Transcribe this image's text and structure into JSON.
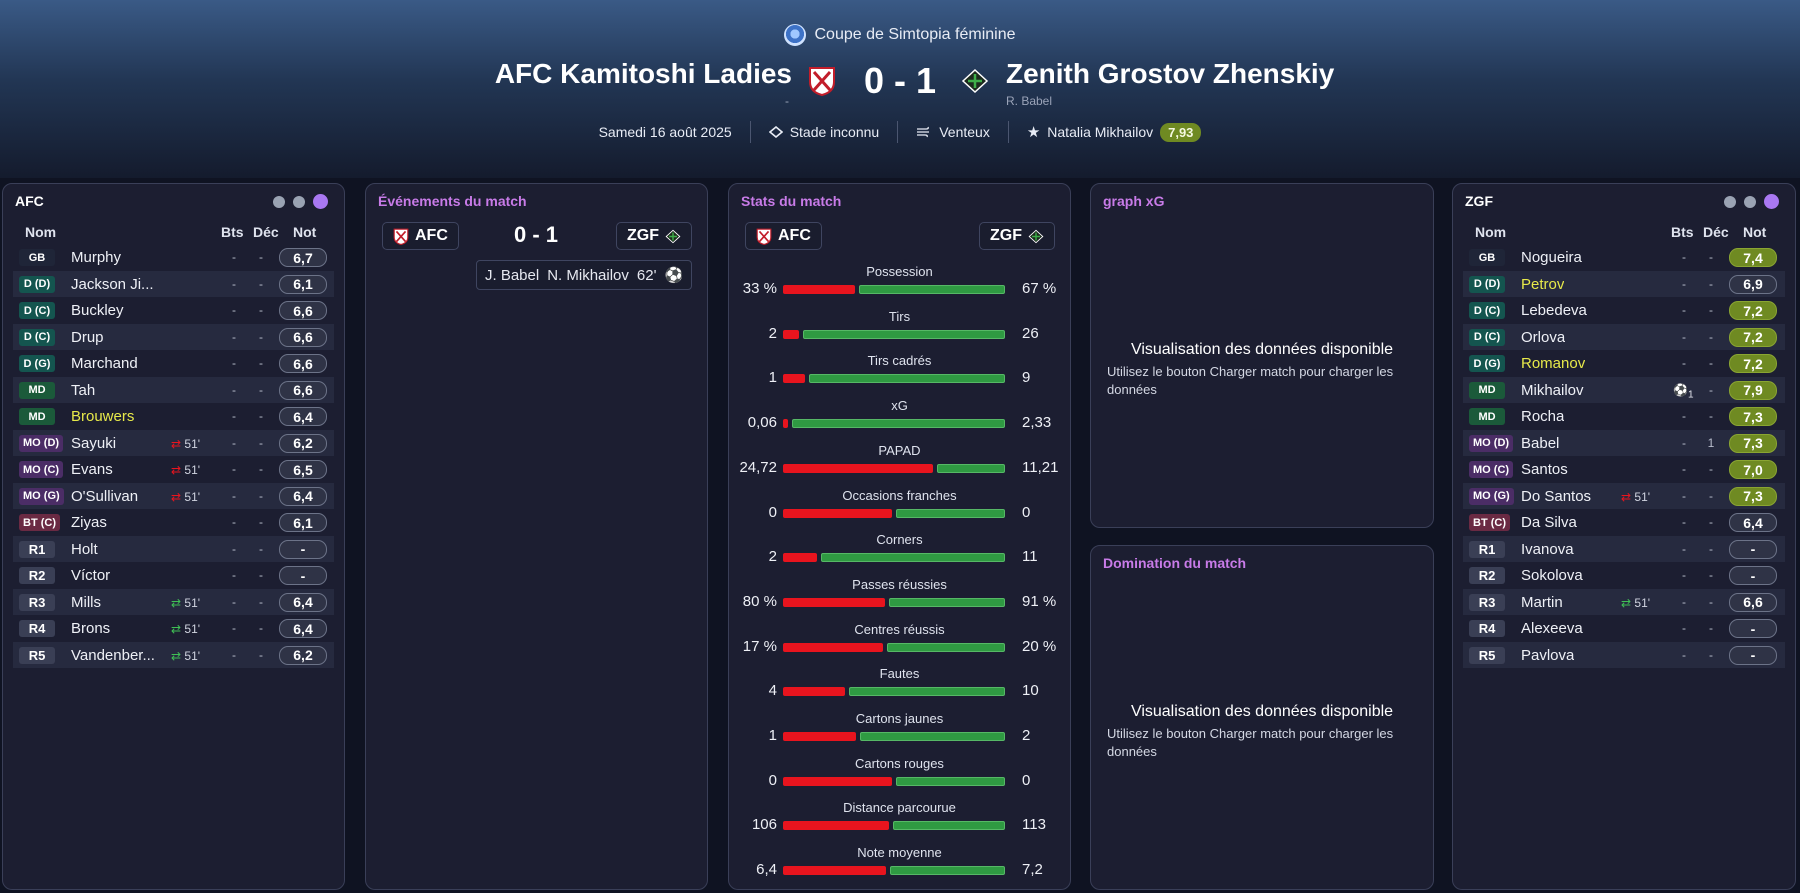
{
  "header": {
    "competition": "Coupe de Simtopia féminine",
    "home_team": "AFC Kamitoshi Ladies",
    "home_scorers": "-",
    "score": "0 - 1",
    "away_team": "Zenith Grostov Zhenskiy",
    "away_scorers": "R. Babel",
    "date": "Samedi 16 août 2025",
    "stadium": "Stade inconnu",
    "weather": "Venteux",
    "player_of_match": "Natalia Mikhailov",
    "player_of_match_rating": "7,93"
  },
  "home_lineup": {
    "title": "AFC",
    "col_name": "Nom",
    "col_goals": "Bts",
    "col_dec": "Déc",
    "col_rating": "Not",
    "rows": [
      {
        "pos": "GB",
        "name": "Murphy",
        "bts": "-",
        "dec": "-",
        "rating": "6,7"
      },
      {
        "pos": "D (D)",
        "name": "Jackson Ji...",
        "bts": "-",
        "dec": "-",
        "rating": "6,1"
      },
      {
        "pos": "D (C)",
        "name": "Buckley",
        "bts": "-",
        "dec": "-",
        "rating": "6,6"
      },
      {
        "pos": "D (C)",
        "name": "Drup",
        "bts": "-",
        "dec": "-",
        "rating": "6,6"
      },
      {
        "pos": "D (G)",
        "name": "Marchand",
        "bts": "-",
        "dec": "-",
        "rating": "6,6"
      },
      {
        "pos": "MD",
        "name": "Tah",
        "bts": "-",
        "dec": "-",
        "rating": "6,6"
      },
      {
        "pos": "MD",
        "name": "Brouwers",
        "bts": "-",
        "dec": "-",
        "rating": "6,4"
      },
      {
        "pos": "MO (D)",
        "name": "Sayuki",
        "sub": "51'",
        "bts": "-",
        "dec": "-",
        "rating": "6,2"
      },
      {
        "pos": "MO (C)",
        "name": "Evans",
        "sub": "51'",
        "bts": "-",
        "dec": "-",
        "rating": "6,5"
      },
      {
        "pos": "MO (G)",
        "name": "O'Sullivan",
        "sub": "51'",
        "bts": "-",
        "dec": "-",
        "rating": "6,4"
      },
      {
        "pos": "BT (C)",
        "name": "Ziyas",
        "bts": "-",
        "dec": "-",
        "rating": "6,1"
      },
      {
        "pos": "R1",
        "name": "Holt",
        "bts": "-",
        "dec": "-",
        "rating": "-"
      },
      {
        "pos": "R2",
        "name": "Víctor",
        "bts": "-",
        "dec": "-",
        "rating": "-"
      },
      {
        "pos": "R3",
        "name": "Mills",
        "sub": "51'",
        "bts": "-",
        "dec": "-",
        "rating": "6,4"
      },
      {
        "pos": "R4",
        "name": "Brons",
        "sub": "51'",
        "bts": "-",
        "dec": "-",
        "rating": "6,4"
      },
      {
        "pos": "R5",
        "name": "Vandenber...",
        "sub": "51'",
        "bts": "-",
        "dec": "-",
        "rating": "6,2"
      }
    ]
  },
  "away_lineup": {
    "title": "ZGF",
    "col_name": "Nom",
    "col_goals": "Bts",
    "col_dec": "Déc",
    "col_rating": "Not",
    "rows": [
      {
        "pos": "GB",
        "name": "Nogueira",
        "bts": "-",
        "dec": "-",
        "rating": "7,4"
      },
      {
        "pos": "D (D)",
        "name": "Petrov",
        "bts": "-",
        "dec": "-",
        "rating": "6,9"
      },
      {
        "pos": "D (C)",
        "name": "Lebedeva",
        "bts": "-",
        "dec": "-",
        "rating": "7,2"
      },
      {
        "pos": "D (C)",
        "name": "Orlova",
        "bts": "-",
        "dec": "-",
        "rating": "7,2"
      },
      {
        "pos": "D (G)",
        "name": "Romanov",
        "bts": "-",
        "dec": "-",
        "rating": "7,2"
      },
      {
        "pos": "MD",
        "name": "Mikhailov",
        "goal": "1",
        "bts": "",
        "dec": "-",
        "rating": "7,9"
      },
      {
        "pos": "MD",
        "name": "Rocha",
        "bts": "-",
        "dec": "-",
        "rating": "7,3"
      },
      {
        "pos": "MO (D)",
        "name": "Babel",
        "bts": "-",
        "dec": "1",
        "rating": "7,3"
      },
      {
        "pos": "MO (C)",
        "name": "Santos",
        "bts": "-",
        "dec": "-",
        "rating": "7,0"
      },
      {
        "pos": "MO (G)",
        "name": "Do Santos",
        "sub": "51'",
        "bts": "-",
        "dec": "-",
        "rating": "7,3"
      },
      {
        "pos": "BT (C)",
        "name": "Da Silva",
        "bts": "-",
        "dec": "-",
        "rating": "6,4"
      },
      {
        "pos": "R1",
        "name": "Ivanova",
        "bts": "-",
        "dec": "-",
        "rating": "-"
      },
      {
        "pos": "R2",
        "name": "Sokolova",
        "bts": "-",
        "dec": "-",
        "rating": "-"
      },
      {
        "pos": "R3",
        "name": "Martin",
        "sub": "51'",
        "bts": "-",
        "dec": "-",
        "rating": "6,6"
      },
      {
        "pos": "R4",
        "name": "Alexeeva",
        "bts": "-",
        "dec": "-",
        "rating": "-"
      },
      {
        "pos": "R5",
        "name": "Pavlova",
        "bts": "-",
        "dec": "-",
        "rating": "-"
      }
    ]
  },
  "events": {
    "title": "Événements du match",
    "home_abbr": "AFC",
    "away_abbr": "ZGF",
    "score": "0 - 1",
    "goal_assist": "J. Babel",
    "goal_scorer": "N. Mikhailov",
    "goal_minute": "62'"
  },
  "stats": {
    "title": "Stats du match",
    "home_abbr": "AFC",
    "away_abbr": "ZGF",
    "rows": [
      {
        "label": "Possession",
        "home": "33 %",
        "away": "67 %",
        "h": 33,
        "a": 67
      },
      {
        "label": "Tirs",
        "home": "2",
        "away": "26",
        "h": 2,
        "a": 26
      },
      {
        "label": "Tirs cadrés",
        "home": "1",
        "away": "9",
        "h": 1,
        "a": 9
      },
      {
        "label": "xG",
        "home": "0,06",
        "away": "2,33",
        "h": 0.06,
        "a": 2.33
      },
      {
        "label": "PAPAD",
        "home": "24,72",
        "away": "11,21",
        "h": 24.72,
        "a": 11.21
      },
      {
        "label": "Occasions franches",
        "home": "0",
        "away": "0",
        "h": 0,
        "a": 0
      },
      {
        "label": "Corners",
        "home": "2",
        "away": "11",
        "h": 2,
        "a": 11
      },
      {
        "label": "Passes réussies",
        "home": "80 %",
        "away": "91 %",
        "h": 80,
        "a": 91
      },
      {
        "label": "Centres réussis",
        "home": "17 %",
        "away": "20 %",
        "h": 17,
        "a": 20
      },
      {
        "label": "Fautes",
        "home": "4",
        "away": "10",
        "h": 4,
        "a": 10
      },
      {
        "label": "Cartons jaunes",
        "home": "1",
        "away": "2",
        "h": 1,
        "a": 2
      },
      {
        "label": "Cartons rouges",
        "home": "0",
        "away": "0",
        "h": 0,
        "a": 0
      },
      {
        "label": "Distance parcourue",
        "home": "106",
        "away": "113",
        "h": 106,
        "a": 113
      },
      {
        "label": "Note moyenne",
        "home": "6,4",
        "away": "7,2",
        "h": 6.4,
        "a": 7.2
      }
    ]
  },
  "xg_graph": {
    "title": "graph xG",
    "message": "Visualisation des données disponible",
    "hint": "Utilisez le bouton Charger match pour charger les données"
  },
  "domination": {
    "title": "Domination du match",
    "message": "Visualisation des données disponible",
    "hint": "Utilisez le bouton Charger match pour charger les données"
  },
  "colors": {
    "home_bar": "#e8141e",
    "away_bar": "#2f9a42",
    "rating_good": "#6f8a22",
    "accent_purple": "#c87be8"
  }
}
